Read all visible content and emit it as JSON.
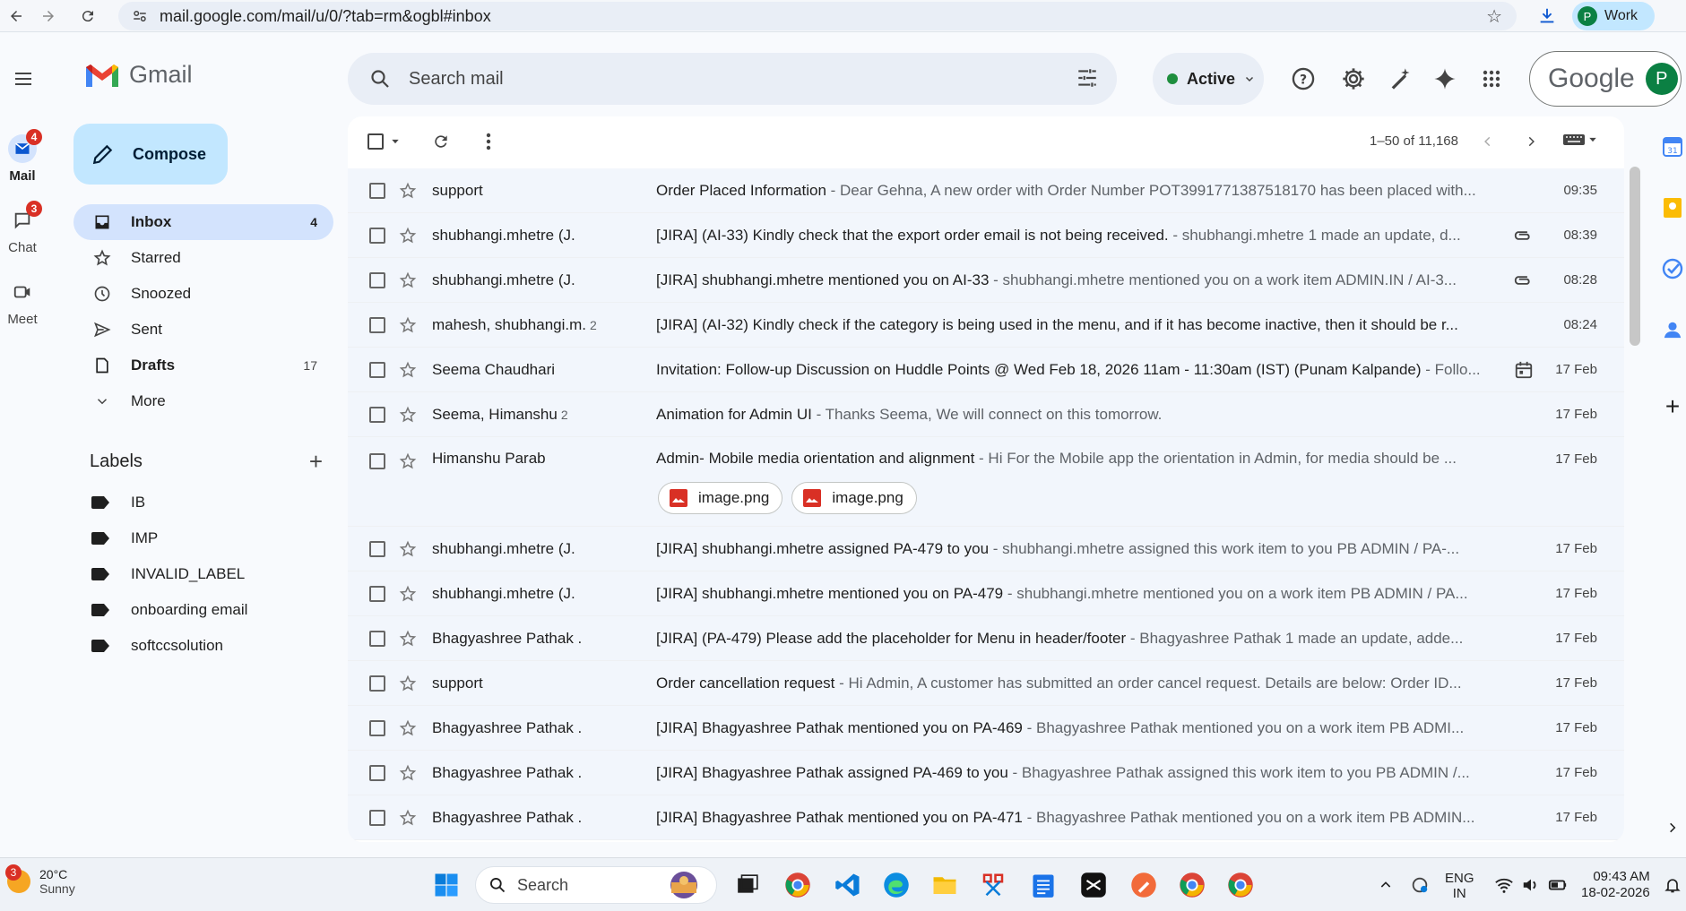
{
  "browser": {
    "url": "mail.google.com/mail/u/0/?tab=rm&ogbl#inbox",
    "profile_initial": "P",
    "profile_label": "Work"
  },
  "rail": {
    "mail_label": "Mail",
    "mail_badge": "4",
    "chat_label": "Chat",
    "chat_badge": "3",
    "meet_label": "Meet"
  },
  "app": {
    "name": "Gmail",
    "compose_label": "Compose"
  },
  "nav": [
    {
      "label": "Inbox",
      "count": "4"
    },
    {
      "label": "Starred",
      "count": ""
    },
    {
      "label": "Snoozed",
      "count": ""
    },
    {
      "label": "Sent",
      "count": ""
    },
    {
      "label": "Drafts",
      "count": "17"
    },
    {
      "label": "More",
      "count": ""
    }
  ],
  "labels": {
    "title": "Labels",
    "items": [
      "IB",
      "IMP",
      "INVALID_LABEL",
      "onboarding email",
      "softccsolution"
    ]
  },
  "header": {
    "search_placeholder": "Search mail",
    "status_label": "Active",
    "account_brand": "Google",
    "account_initial": "P"
  },
  "toolbar": {
    "pager_text": "1–50 of 11,168"
  },
  "emails": [
    {
      "sender": "support",
      "count": "",
      "subject": "Order Placed Information",
      "snippet": " - Dear Gehna, A new order with Order Number POT3991771387518170 has been placed with...",
      "time": "09:35",
      "attachment": ""
    },
    {
      "sender": "shubhangi.mhetre (J.",
      "count": "",
      "subject": "[JIRA] (AI-33) Kindly check that the export order email is not being received.",
      "snippet": " - shubhangi.mhetre 1 made an update, d...",
      "time": "08:39",
      "attachment": "clip"
    },
    {
      "sender": "shubhangi.mhetre (J.",
      "count": "",
      "subject": "[JIRA] shubhangi.mhetre mentioned you on AI-33",
      "snippet": " - shubhangi.mhetre mentioned you on a work item ADMIN.IN / AI-3...",
      "time": "08:28",
      "attachment": "clip"
    },
    {
      "sender": "mahesh, shubhangi.m.",
      "count": "2",
      "subject": "[JIRA] (AI-32) Kindly check if the category is being used in the menu, and if it has become inactive, then it should be r...",
      "snippet": "",
      "time": "08:24",
      "attachment": ""
    },
    {
      "sender": "Seema Chaudhari",
      "count": "",
      "subject": "Invitation: Follow-up Discussion on Huddle Points @ Wed Feb 18, 2026 11am - 11:30am (IST) (Punam Kalpande)",
      "snippet": " - Follo...",
      "time": "17 Feb",
      "attachment": "calendar"
    },
    {
      "sender": "Seema, Himanshu",
      "count": "2",
      "subject": "Animation for Admin UI",
      "snippet": " - Thanks Seema, We will connect on this tomorrow.",
      "time": "17 Feb",
      "attachment": ""
    },
    {
      "sender": "Himanshu Parab",
      "count": "",
      "subject": "Admin- Mobile media orientation and alignment",
      "snippet": " - Hi For the Mobile app the orientation in Admin, for media should be ...",
      "time": "17 Feb",
      "attachment": "",
      "files": [
        "image.png",
        "image.png"
      ]
    },
    {
      "sender": "shubhangi.mhetre (J.",
      "count": "",
      "subject": "[JIRA] shubhangi.mhetre assigned PA-479 to you",
      "snippet": " - shubhangi.mhetre assigned this work item to you PB ADMIN / PA-...",
      "time": "17 Feb",
      "attachment": ""
    },
    {
      "sender": "shubhangi.mhetre (J.",
      "count": "",
      "subject": "[JIRA] shubhangi.mhetre mentioned you on PA-479",
      "snippet": " - shubhangi.mhetre mentioned you on a work item PB ADMIN / PA...",
      "time": "17 Feb",
      "attachment": ""
    },
    {
      "sender": "Bhagyashree Pathak .",
      "count": "",
      "subject": "[JIRA] (PA-479) Please add the placeholder for Menu in header/footer",
      "snippet": " - Bhagyashree Pathak 1 made an update, adde...",
      "time": "17 Feb",
      "attachment": ""
    },
    {
      "sender": "support",
      "count": "",
      "subject": "Order cancellation request",
      "snippet": " - Hi Admin, A customer has submitted an order cancel request. Details are below: Order ID...",
      "time": "17 Feb",
      "attachment": ""
    },
    {
      "sender": "Bhagyashree Pathak .",
      "count": "",
      "subject": "[JIRA] Bhagyashree Pathak mentioned you on PA-469",
      "snippet": " - Bhagyashree Pathak mentioned you on a work item PB ADMI...",
      "time": "17 Feb",
      "attachment": ""
    },
    {
      "sender": "Bhagyashree Pathak .",
      "count": "",
      "subject": "[JIRA] Bhagyashree Pathak assigned PA-469 to you",
      "snippet": " - Bhagyashree Pathak assigned this work item to you PB ADMIN /...",
      "time": "17 Feb",
      "attachment": ""
    },
    {
      "sender": "Bhagyashree Pathak .",
      "count": "",
      "subject": "[JIRA] Bhagyashree Pathak mentioned you on PA-471",
      "snippet": " - Bhagyashree Pathak mentioned you on a work item PB ADMIN...",
      "time": "17 Feb",
      "attachment": ""
    }
  ],
  "taskbar": {
    "weather_badge": "3",
    "temperature": "20°C",
    "condition": "Sunny",
    "search_label": "Search",
    "lang_top": "ENG",
    "lang_bottom": "IN",
    "time": "09:43 AM",
    "date": "18-02-2026"
  },
  "colors": {
    "accent": "#0b57d0",
    "compose_bg": "#c2e7ff",
    "selected_nav": "#d3e3fd",
    "badge": "#d93025",
    "active_dot": "#1e8e3e"
  }
}
